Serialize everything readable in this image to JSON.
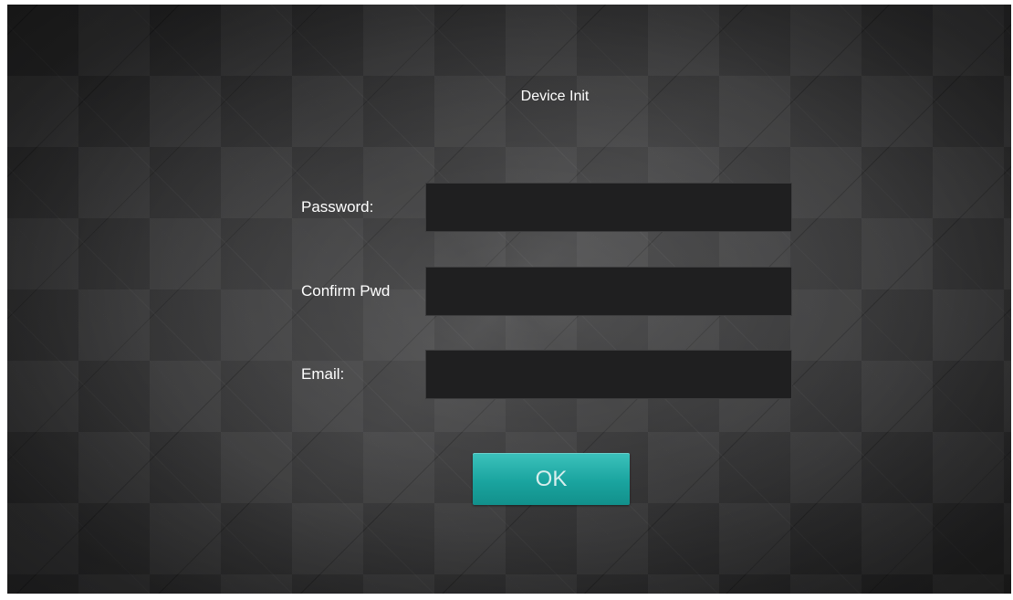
{
  "header": {
    "title": "Device Init"
  },
  "form": {
    "password": {
      "label": "Password:",
      "value": "",
      "placeholder": ""
    },
    "confirm_password": {
      "label": "Confirm Pwd",
      "value": "",
      "placeholder": ""
    },
    "email": {
      "label": "Email:",
      "value": "",
      "placeholder": ""
    },
    "ok_label": "OK"
  },
  "colors": {
    "background": "#333334",
    "field_background": "#1f1f20",
    "accent": "#1aa49f",
    "text": "#ffffff"
  }
}
